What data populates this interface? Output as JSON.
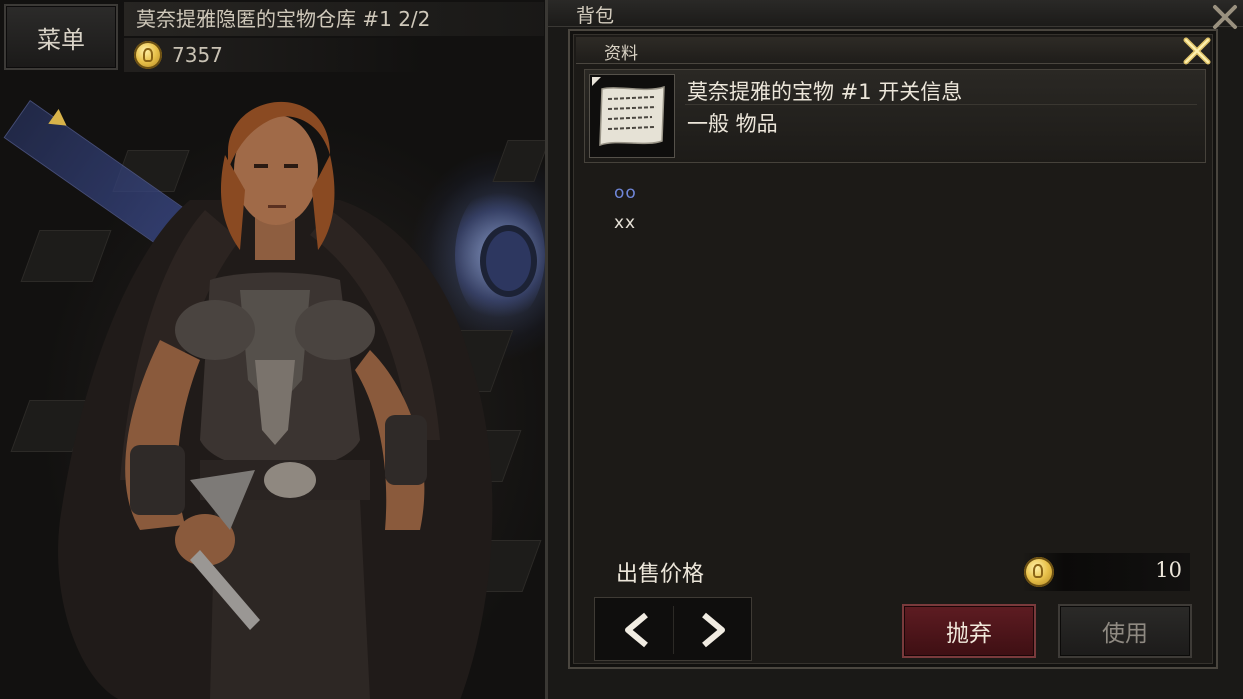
{
  "hud": {
    "menu_label": "菜单",
    "map_title": "莫奈提雅隐匿的宝物仓库 #1 2/2",
    "gold": "7357"
  },
  "inventory": {
    "title": "背包",
    "info_dialog": {
      "tab_label": "资料",
      "item": {
        "name": "莫奈提雅的宝物 #1 开关信息",
        "type": "一般 物品",
        "icon": "parchment-scroll-icon"
      },
      "description_line1": "oo",
      "description_line2": "xx",
      "price_label": "出售价格",
      "price_value": "10",
      "discard_label": "抛弃",
      "use_label": "使用"
    }
  },
  "colors": {
    "discard_button": "#5e1c22",
    "gold": "#e8c14a",
    "description_accent": "#6f86d8"
  }
}
